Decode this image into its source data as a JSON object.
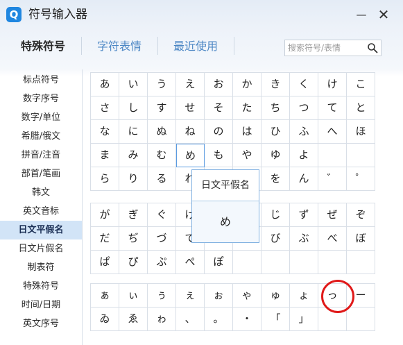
{
  "titlebar": {
    "logo_letter": "Q",
    "title": "符号输入器",
    "minimize_glyph": "—",
    "close_glyph": "✕"
  },
  "tabs": [
    {
      "label": "特殊符号",
      "active": true
    },
    {
      "label": "字符表情",
      "active": false
    },
    {
      "label": "最近使用",
      "active": false
    }
  ],
  "search": {
    "placeholder": "搜索符号/表情"
  },
  "sidebar": {
    "items": [
      {
        "label": "标点符号"
      },
      {
        "label": "数字序号"
      },
      {
        "label": "数字/单位"
      },
      {
        "label": "希腊/俄文"
      },
      {
        "label": "拼音/注音"
      },
      {
        "label": "部首/笔画"
      },
      {
        "label": "韩文"
      },
      {
        "label": "英文音标"
      },
      {
        "label": "日文平假名",
        "active": true
      },
      {
        "label": "日文片假名"
      },
      {
        "label": "制表符"
      },
      {
        "label": "特殊符号"
      },
      {
        "label": "时间/日期"
      },
      {
        "label": "英文序号"
      }
    ]
  },
  "grids": [
    {
      "rows": [
        [
          "あ",
          "い",
          "う",
          "え",
          "お",
          "か",
          "き",
          "く",
          "け",
          "こ"
        ],
        [
          "さ",
          "し",
          "す",
          "せ",
          "そ",
          "た",
          "ち",
          "つ",
          "て",
          "と"
        ],
        [
          "な",
          "に",
          "ぬ",
          "ね",
          "の",
          "は",
          "ひ",
          "ふ",
          "へ",
          "ほ"
        ],
        [
          "ま",
          "み",
          "む",
          "め",
          "も",
          "や",
          "ゆ",
          "よ",
          "",
          ""
        ],
        [
          "ら",
          "り",
          "る",
          "れ",
          "ろ",
          "わ",
          "を",
          "ん",
          "゛",
          "゜"
        ]
      ]
    },
    {
      "rows": [
        [
          "が",
          "ぎ",
          "ぐ",
          "げ",
          "ご",
          "ざ",
          "じ",
          "ず",
          "ぜ",
          "ぞ"
        ],
        [
          "だ",
          "ぢ",
          "づ",
          "で",
          "ど",
          "ば",
          "び",
          "ぶ",
          "べ",
          "ぼ"
        ],
        [
          "ぱ",
          "ぴ",
          "ぷ",
          "ぺ",
          "ぽ",
          "",
          "",
          "",
          "",
          ""
        ]
      ]
    },
    {
      "rows": [
        [
          "ぁ",
          "ぃ",
          "ぅ",
          "ぇ",
          "ぉ",
          "ゃ",
          "ゅ",
          "ょ",
          "っ",
          "ー"
        ],
        [
          "ゐ",
          "ゑ",
          "ゎ",
          "、",
          "。",
          "・",
          "「",
          "」",
          "",
          ""
        ]
      ]
    }
  ],
  "tooltip": {
    "title": "日文平假名",
    "char": "め"
  }
}
